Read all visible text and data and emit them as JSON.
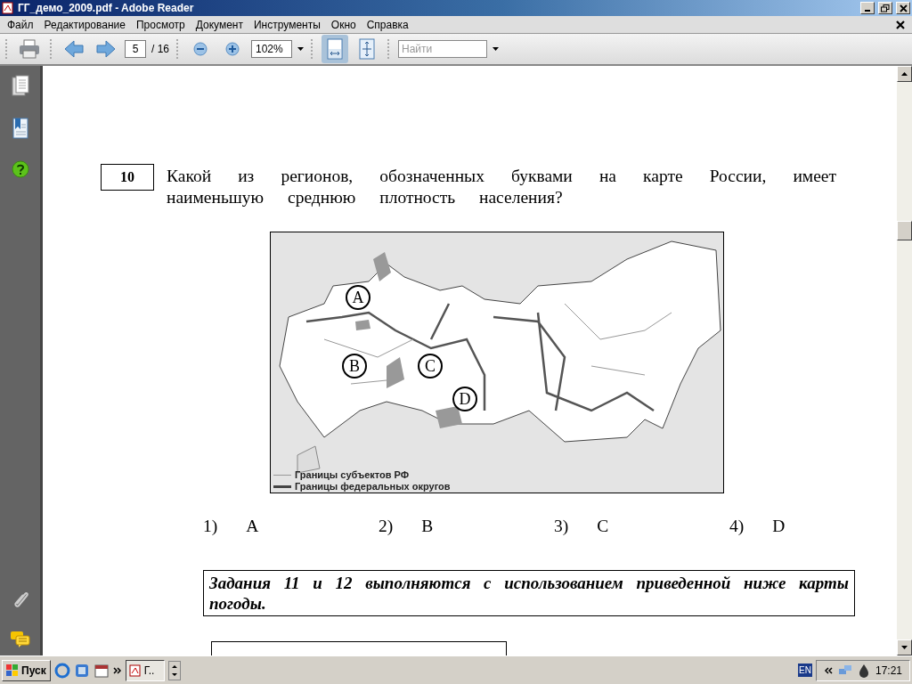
{
  "window": {
    "title": "ГГ_демо_2009.pdf - Adobe Reader"
  },
  "menu": [
    "Файл",
    "Редактирование",
    "Просмотр",
    "Документ",
    "Инструменты",
    "Окно",
    "Справка"
  ],
  "toolbar": {
    "page": "5",
    "page_total": "/ 16",
    "zoom": "102%",
    "search": {
      "placeholder": "Найти"
    },
    "view_buttons": [
      {
        "selected": true
      },
      {
        "selected": false
      }
    ]
  },
  "document": {
    "question": {
      "number": "10",
      "text": "Какой из регионов, обозначенных буквами на карте России, имеет наименьшую среднюю плотность населения?"
    },
    "map": {
      "markers": [
        {
          "label": "A"
        },
        {
          "label": "B"
        },
        {
          "label": "C"
        },
        {
          "label": "D"
        }
      ],
      "legend": [
        {
          "kind": "thin",
          "text": "Границы субъектов РФ"
        },
        {
          "kind": "thick",
          "text": "Границы федеральных округов"
        }
      ]
    },
    "answers": [
      {
        "number": "1)",
        "label": "A"
      },
      {
        "number": "2)",
        "label": "B"
      },
      {
        "number": "3)",
        "label": "C"
      },
      {
        "number": "4)",
        "label": "D"
      }
    ],
    "note": "Задания 11 и 12 выполняются с использованием приведенной ниже карты погоды."
  },
  "taskbar": {
    "start": "Пуск",
    "task": "Г..",
    "language": "EN",
    "clock": "17:21"
  }
}
